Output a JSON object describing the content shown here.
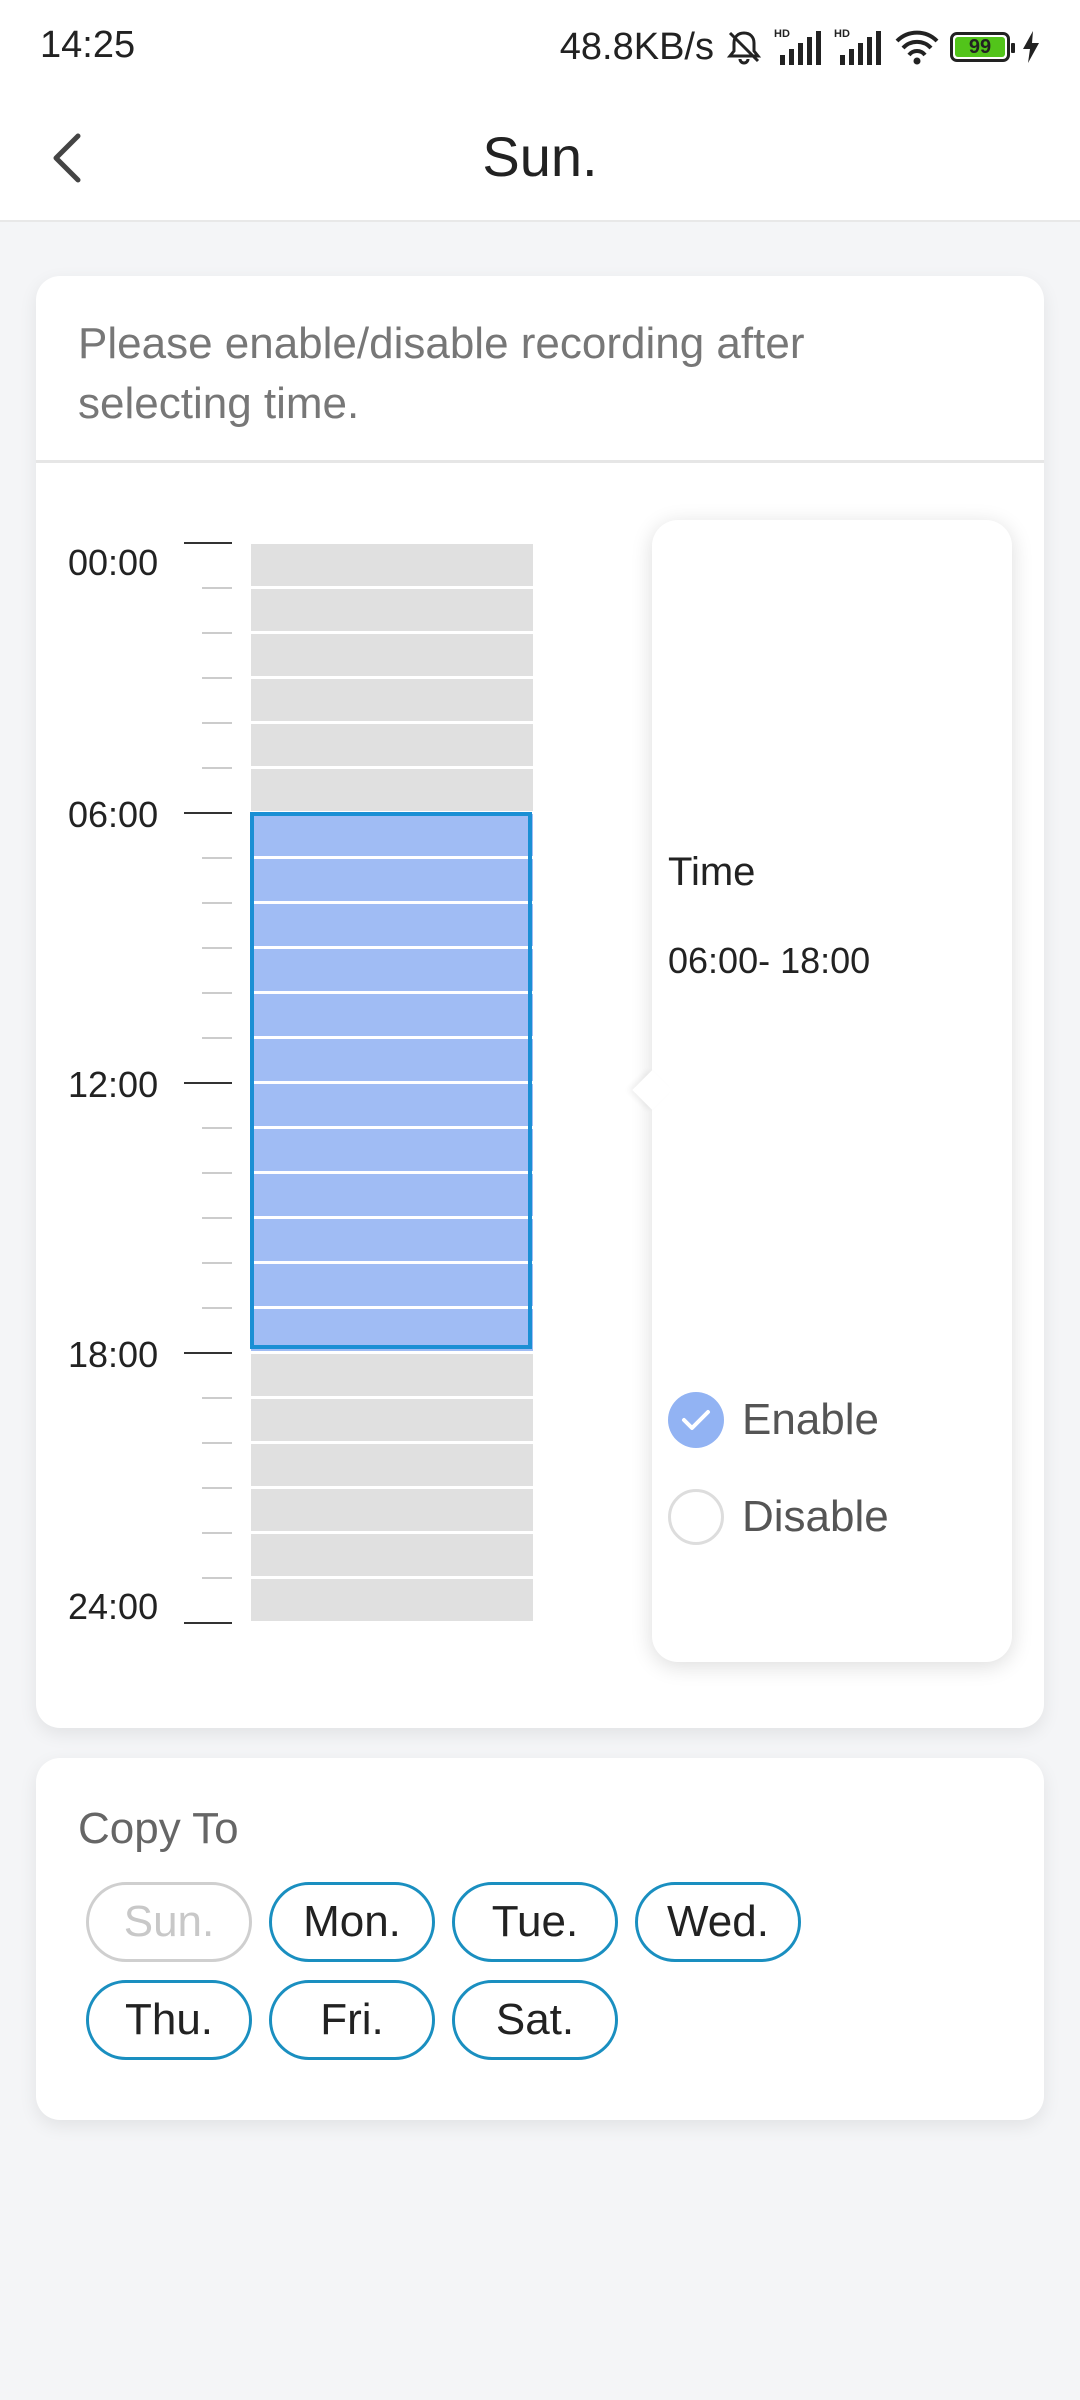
{
  "status_bar": {
    "time": "14:25",
    "network_speed": "48.8KB/s",
    "battery_level": "99",
    "icons": [
      "mute-icon",
      "signal-hd-icon",
      "signal-hd-icon",
      "wifi-icon",
      "battery-icon",
      "charging-icon"
    ]
  },
  "header": {
    "title": "Sun.",
    "back_icon": "chevron-left-icon"
  },
  "schedule": {
    "hint": "Please enable/disable recording after selecting time.",
    "time_labels": [
      "00:00",
      "06:00",
      "12:00",
      "18:00",
      "24:00"
    ],
    "selected_start_hour": 6,
    "selected_end_hour": 18,
    "slot_colors": {
      "empty": "#e0e0e0",
      "selected": "#a0bcf4",
      "selection_border": "#1a8fd4"
    }
  },
  "popup": {
    "time_title": "Time",
    "time_range": "06:00- 18:00",
    "options": [
      {
        "label": "Enable",
        "checked": true
      },
      {
        "label": "Disable",
        "checked": false
      }
    ]
  },
  "copy_to": {
    "title": "Copy To",
    "days": [
      {
        "label": "Sun.",
        "enabled": false
      },
      {
        "label": "Mon.",
        "enabled": true
      },
      {
        "label": "Tue.",
        "enabled": true
      },
      {
        "label": "Wed.",
        "enabled": true
      },
      {
        "label": "Thu.",
        "enabled": true
      },
      {
        "label": "Fri.",
        "enabled": true
      },
      {
        "label": "Sat.",
        "enabled": true
      }
    ],
    "accent_color": "#1a8fc0"
  }
}
